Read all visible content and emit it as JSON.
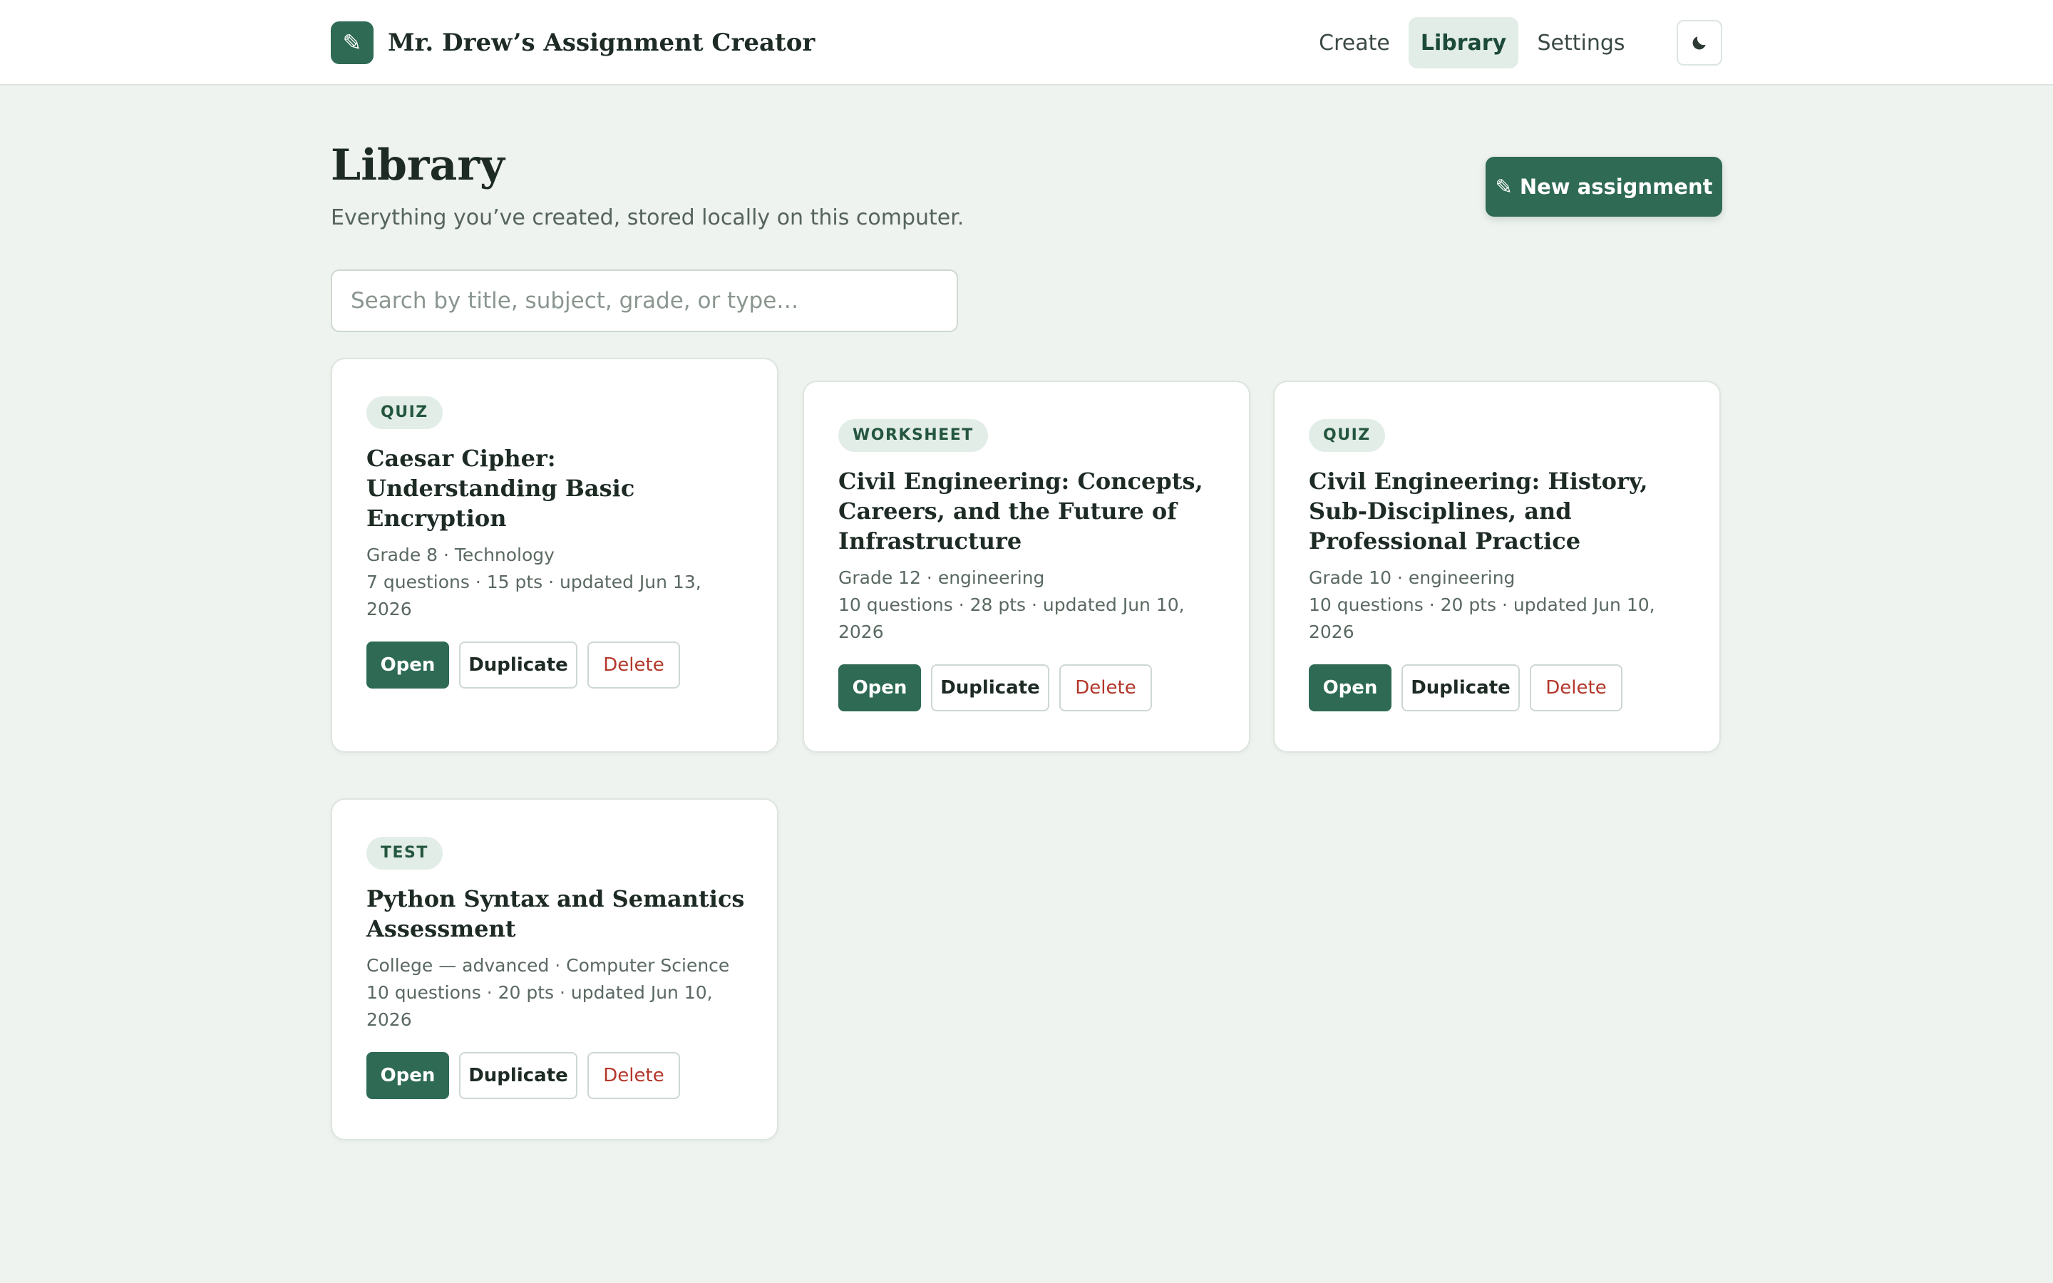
{
  "app": {
    "title": "Mr. Drew’s Assignment Creator",
    "logo_glyph": "✎",
    "accent_color": "#2e6a54"
  },
  "nav": {
    "create": "Create",
    "library": "Library",
    "settings": "Settings",
    "active": "library",
    "theme_icon": "moon-icon"
  },
  "page": {
    "title": "Library",
    "subtitle": "Everything you’ve created, stored locally on this computer.",
    "new_button_icon": "✎",
    "new_button_label": "New assignment"
  },
  "search": {
    "placeholder": "Search by title, subject, grade, or type…",
    "value": ""
  },
  "actions": {
    "open": "Open",
    "duplicate": "Duplicate",
    "delete": "Delete"
  },
  "assignments": [
    {
      "type": "QUIZ",
      "title": "Caesar Cipher: Understanding Basic Encryption",
      "grade_subject": "Grade 8 · Technology",
      "stats": "7 questions · 15 pts · updated Jun 13, 2026"
    },
    {
      "type": "WORKSHEET",
      "title": "Civil Engineering: Concepts, Careers, and the Future of Infrastructure",
      "grade_subject": "Grade 12 · engineering",
      "stats": "10 questions · 28 pts · updated Jun 10, 2026"
    },
    {
      "type": "QUIZ",
      "title": "Civil Engineering: History, Sub-Disciplines, and Professional Practice",
      "grade_subject": "Grade 10 · engineering",
      "stats": "10 questions · 20 pts · updated Jun 10, 2026"
    },
    {
      "type": "TEST",
      "title": "Python Syntax and Semantics Assessment",
      "grade_subject": "College — advanced · Computer Science",
      "stats": "10 questions · 20 pts · updated Jun 10, 2026"
    }
  ]
}
